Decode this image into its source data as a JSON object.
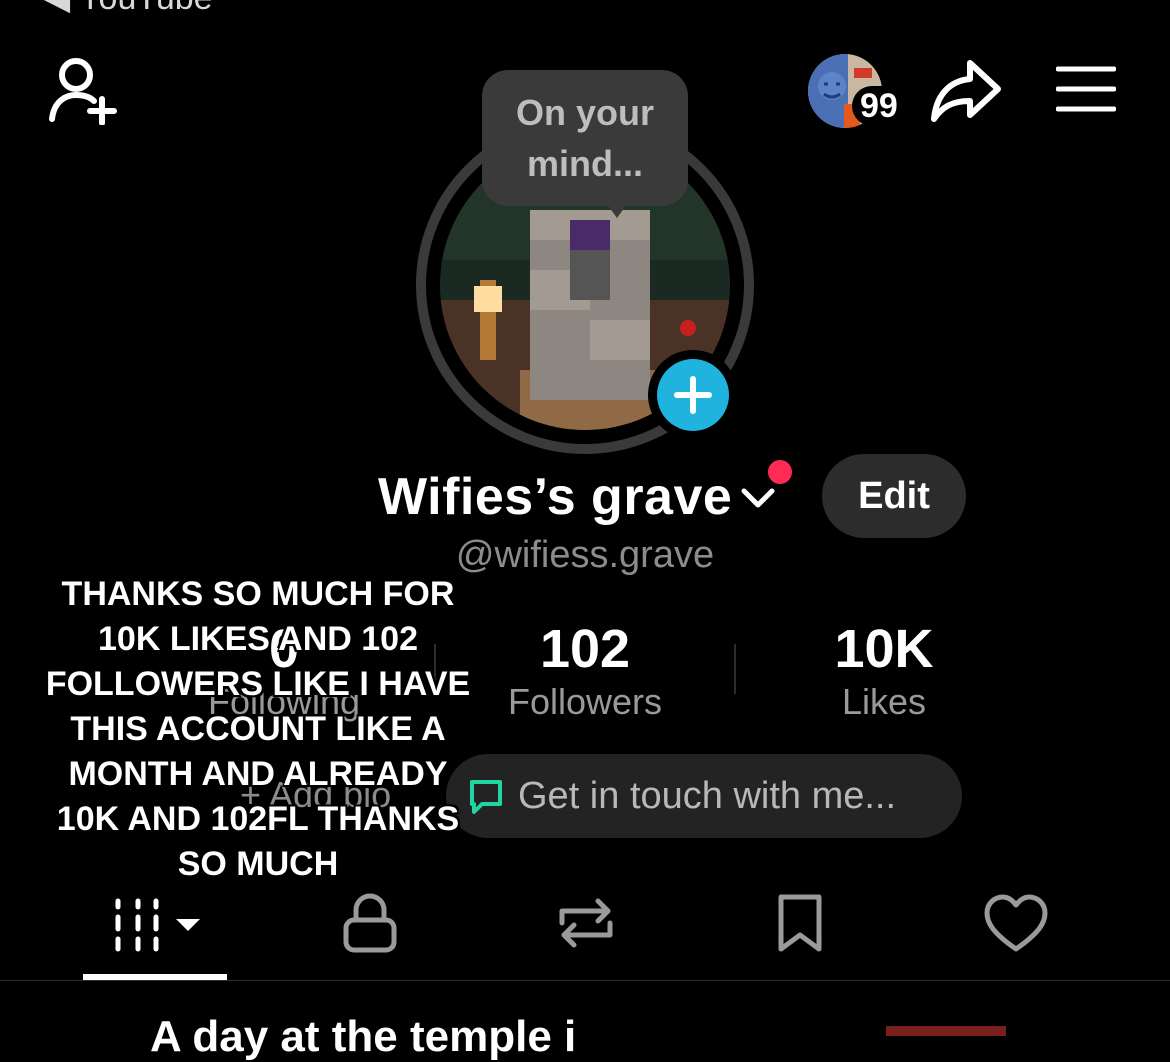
{
  "status_bar": {
    "back_label": "◀ YouTube"
  },
  "header": {
    "notification_count": "99"
  },
  "story_bubble": {
    "text": "On your mind..."
  },
  "profile": {
    "display_name": "Wifies’s grave",
    "handle": "@wifiess.grave",
    "edit_label": "Edit",
    "stats": [
      {
        "value": "0",
        "label": "Following"
      },
      {
        "value": "102",
        "label": "Followers"
      },
      {
        "value": "10K",
        "label": "Likes"
      }
    ],
    "add_bio_label": "+ Add bio",
    "contact_placeholder": "Get in touch with me..."
  },
  "overlay_caption": "THANKS SO MUCH FOR 10K LIKES AND 102 FOLLOWERS LIKE I HAVE THIS ACCOUNT LIKE A MONTH AND ALREADY 10K AND 102FL THANKS SO MUCH",
  "tabs": [
    {
      "icon": "grid-videos-icon"
    },
    {
      "icon": "lock-icon"
    },
    {
      "icon": "repost-icon"
    },
    {
      "icon": "bookmark-icon"
    },
    {
      "icon": "heart-icon"
    }
  ],
  "peek_text": "A day at the temple i",
  "colors": {
    "accent_blue": "#1fb3de",
    "notification_red": "#fe2c55",
    "background": "#000000",
    "button_gray": "#2c2c2c"
  }
}
